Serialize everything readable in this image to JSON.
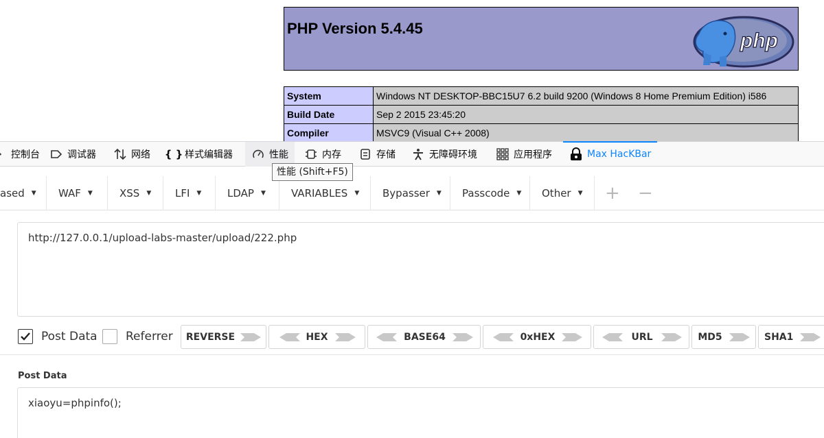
{
  "phpinfo": {
    "title": "PHP Version 5.4.45",
    "logo_text": "php",
    "rows": [
      {
        "key": "System",
        "value": "Windows NT DESKTOP-BBC15U7 6.2 build 9200 (Windows 8 Home Premium Edition) i586"
      },
      {
        "key": "Build Date",
        "value": "Sep 2 2015 23:45:20"
      },
      {
        "key": "Compiler",
        "value": "MSVC9 (Visual C++ 2008)"
      }
    ]
  },
  "devtools": {
    "tabs": [
      {
        "label": "控制台",
        "icon": "console-icon"
      },
      {
        "label": "调试器",
        "icon": "debugger-icon"
      },
      {
        "label": "网络",
        "icon": "network-icon"
      },
      {
        "label": "样式编辑器",
        "icon": "style-editor-icon"
      },
      {
        "label": "性能",
        "icon": "performance-icon"
      },
      {
        "label": "内存",
        "icon": "memory-icon"
      },
      {
        "label": "存储",
        "icon": "storage-icon"
      },
      {
        "label": "无障碍环境",
        "icon": "accessibility-icon"
      },
      {
        "label": "应用程序",
        "icon": "application-icon"
      },
      {
        "label": "Max HacKBar",
        "icon": "hackbar-icon"
      }
    ],
    "tooltip": "性能 (Shift+F5)",
    "accent_color": "#0a84ff"
  },
  "hackbar": {
    "menu": [
      "ased",
      "WAF",
      "XSS",
      "LFI",
      "LDAP",
      "VARIABLES",
      "Bypasser",
      "Passcode",
      "Other"
    ],
    "add_symbol": "+",
    "remove_symbol": "−",
    "url": "http://127.0.0.1/upload-labs-master/upload/222.php",
    "post_data_checkbox": {
      "label": "Post Data",
      "checked": true
    },
    "referrer_checkbox": {
      "label": "Referrer",
      "checked": false
    },
    "encoders": [
      "REVERSE",
      "HEX",
      "BASE64",
      "0xHEX",
      "URL",
      "MD5",
      "SHA1"
    ],
    "post_data_label": "Post Data",
    "post_data": "xiaoyu=phpinfo();"
  }
}
